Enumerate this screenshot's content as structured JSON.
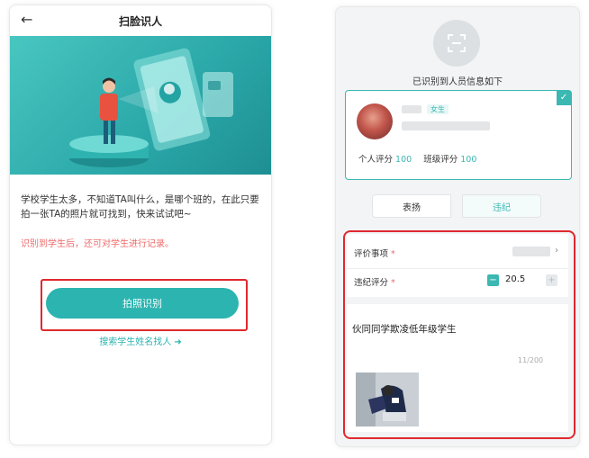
{
  "left_screen": {
    "header": {
      "back_icon": "arrow-left-icon",
      "title": "扫脸识人"
    },
    "description": "学校学生太多，不知道TA叫什么，是哪个班的，在此只要拍一张TA的照片就可找到，快来试试吧~",
    "note": "识别到学生后，还可对学生进行记录。",
    "primary_button": "拍照识别",
    "search_link": "搜索学生姓名找人 ➜"
  },
  "right_screen": {
    "scan_icon": "scan-frame-icon",
    "recognized_title": "已识别到人员信息如下",
    "person_card": {
      "tag": "女生",
      "personal_score_label": "个人评分",
      "personal_score": "100",
      "class_score_label": "班级评分",
      "class_score": "100",
      "selected": true
    },
    "segment": {
      "praise": "表扬",
      "violation": "违纪",
      "active": "违纪"
    },
    "form": {
      "item_label": "评价事项",
      "score_label": "违纪评分",
      "required_mark": "*",
      "score_value": "20.5",
      "minus": "−",
      "plus": "+",
      "incident_text": "伙同同学欺凌低年级学生",
      "counter": "11/200"
    }
  },
  "colors": {
    "accent": "#2cb4b0",
    "highlight": "#e0282e",
    "note": "#ef6a6a"
  }
}
